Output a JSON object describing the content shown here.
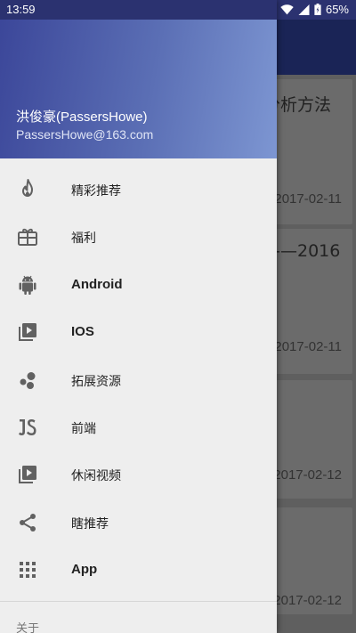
{
  "status_bar": {
    "time": "13:59",
    "battery": "65%"
  },
  "user": {
    "name": "洪俊豪(PassersHowe)",
    "email": "PassersHowe@163.com"
  },
  "menu": [
    {
      "label": "精彩推荐",
      "icon": "fire-icon"
    },
    {
      "label": "福利",
      "icon": "gift-icon"
    },
    {
      "label": "Android",
      "icon": "android-icon"
    },
    {
      "label": "IOS",
      "icon": "video-library-icon"
    },
    {
      "label": "拓展资源",
      "icon": "bubbles-icon"
    },
    {
      "label": "前端",
      "icon": "js-icon"
    },
    {
      "label": "休闲视频",
      "icon": "video-library-icon"
    },
    {
      "label": "瞎推荐",
      "icon": "share-icon"
    },
    {
      "label": "App",
      "icon": "apps-grid-icon"
    }
  ],
  "about_label": "关于",
  "background_list": [
    {
      "title": "分析方法",
      "date": "2017-02-11"
    },
    {
      "title": "——2016",
      "date": "2017-02-11"
    },
    {
      "title": "",
      "date": "2017-02-12"
    },
    {
      "title": "",
      "date": "2017-02-12"
    }
  ]
}
